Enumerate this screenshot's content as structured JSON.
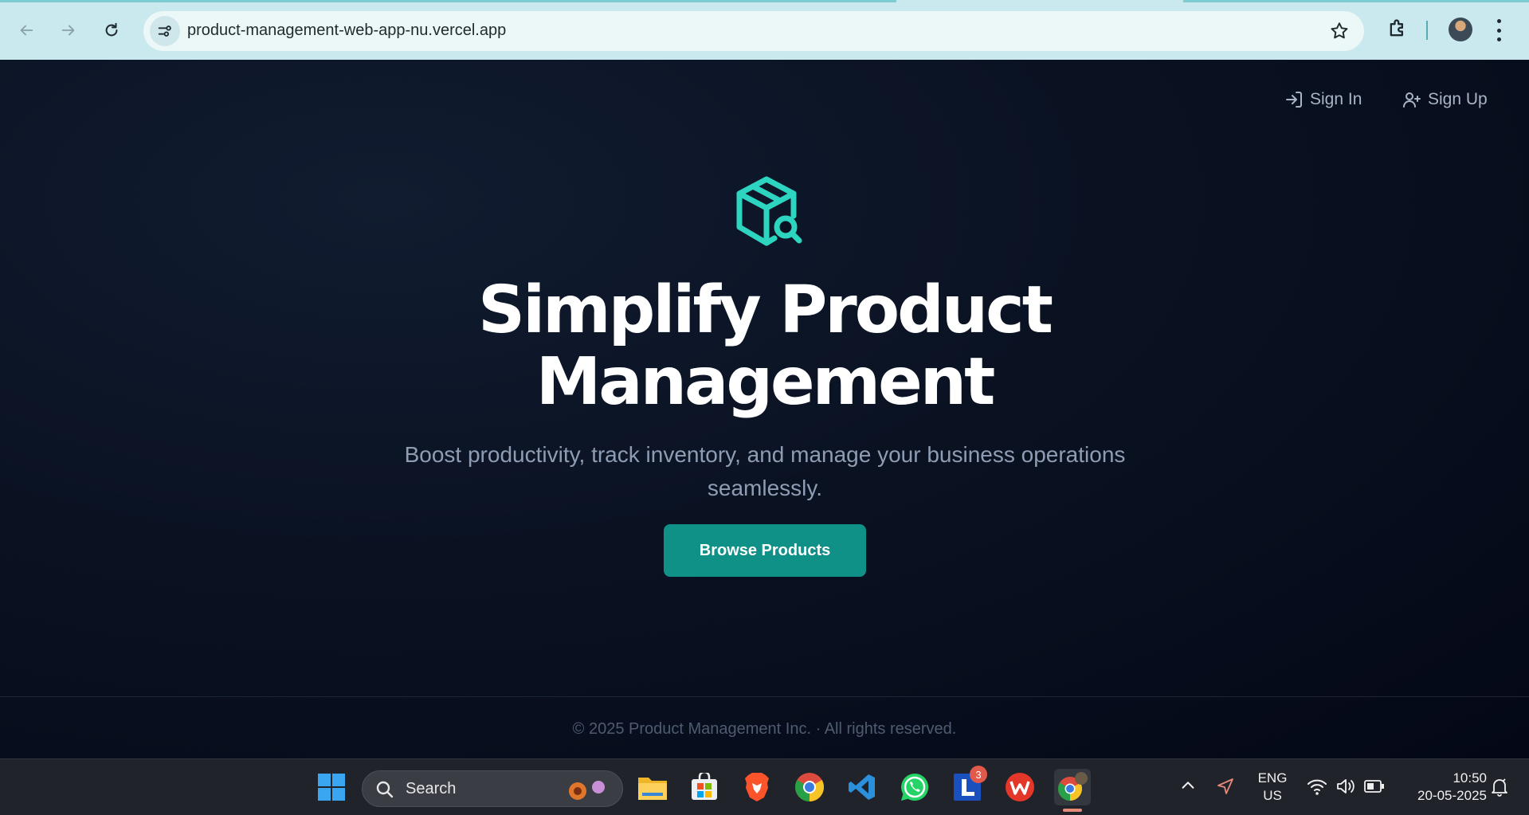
{
  "browser": {
    "url": "product-management-web-app-nu.vercel.app",
    "icons": [
      "back-icon",
      "forward-icon",
      "reload-icon",
      "site-info-icon",
      "bookmark-star-icon",
      "extensions-icon",
      "profile-avatar",
      "menu-icon"
    ]
  },
  "nav": {
    "sign_in": "Sign In",
    "sign_up": "Sign Up"
  },
  "hero": {
    "title_line1": "Simplify Product",
    "title_line2": "Management",
    "subtitle_line1": "Boost productivity, track inventory, and manage your business operations",
    "subtitle_line2": "seamlessly.",
    "cta": "Browse Products",
    "accent_color": "#2dd4bf",
    "button_color": "#0f9187"
  },
  "footer": {
    "text": "© 2025 Product Management Inc. · All rights reserved."
  },
  "taskbar": {
    "search_placeholder": "Search",
    "apps": [
      "start-icon",
      "file-explorer-icon",
      "microsoft-store-icon",
      "brave-icon",
      "chrome-icon",
      "vscode-icon",
      "whatsapp-icon",
      "linkedin-learning-icon",
      "wps-office-icon",
      "chrome-profile-icon"
    ],
    "notification_badge": "3",
    "language_line1": "ENG",
    "language_line2": "US",
    "time": "10:50",
    "date": "20-05-2025"
  }
}
